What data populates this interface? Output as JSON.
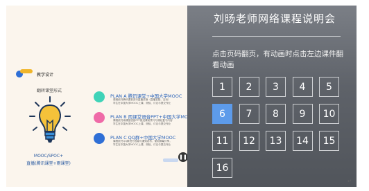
{
  "slide": {
    "section_tag": "教学设计",
    "mode_title": "翻转课堂形式",
    "mooc_line1": "MOOC/SPOC+",
    "mooc_line2": "直播(腾讯课堂+雨课堂)",
    "plans": [
      {
        "title": "PLAN A  腾讯课堂+中国大学MOOC",
        "color": "#3fd3b8",
        "desc": [
          "课程依托腾讯课堂进行直播讲授（直播答疑、互动）",
          "学生在中国大学MOOC上课、测验、讨论与提交作业"
        ]
      },
      {
        "title": "PLAN B  雨课堂语音PPT+中国大学MOOC",
        "color": "#ef6aa7",
        "desc": [
          "课程依托雨课堂语音PPT推送课前预习与课后复习内容",
          "学生在中国大学MOOC上课、测验、讨论与提交作业"
        ]
      },
      {
        "title": "PLAN C  QQ群+中国大学MOOC",
        "color": "#2f6fd6",
        "desc": [
          "课程依托QQ群进行答疑与通知发布，使用屏幕分享，",
          "学生在中国大学MOOC上课、测验、讨论与提交作业"
        ]
      }
    ],
    "play_icon": "pause-icon"
  },
  "panel": {
    "title": "刘旸老师网络课程说明会",
    "hint": "点击页码翻页，有动画时点击左边课件翻看动画",
    "pages": [
      "1",
      "2",
      "3",
      "4",
      "5",
      "6",
      "7",
      "8",
      "9",
      "10",
      "11",
      "12",
      "13",
      "14",
      "15",
      "16"
    ],
    "active_page": "6",
    "accent_color": "#5d9bea"
  },
  "return_mark": "↵"
}
